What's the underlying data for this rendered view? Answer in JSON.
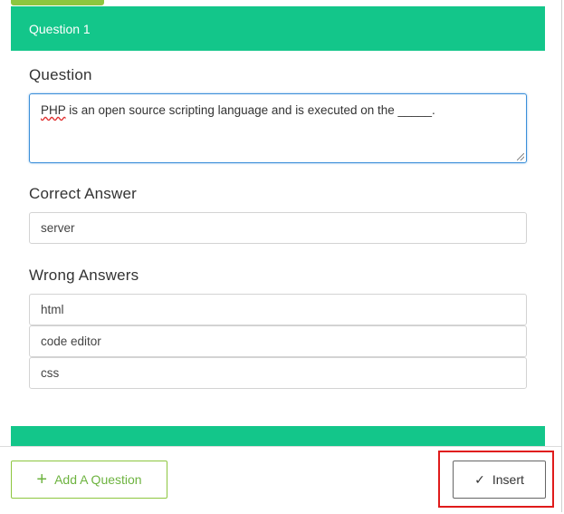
{
  "question1": {
    "header": "Question 1",
    "question_label": "Question",
    "question_text_part1": "PHP",
    "question_text_part2": " is an open source scripting language and is executed on the _____.",
    "correct_label": "Correct Answer",
    "correct_value": "server",
    "wrong_label": "Wrong Answers",
    "wrong_values": [
      "html",
      "code editor",
      "css"
    ]
  },
  "footer": {
    "add_label": "Add A Question",
    "add_icon": "+",
    "insert_label": "Insert",
    "insert_icon": "✓"
  },
  "colors": {
    "header_green": "#13c68a",
    "accent_green": "#8dc63f",
    "highlight_red": "#e01b1b"
  }
}
